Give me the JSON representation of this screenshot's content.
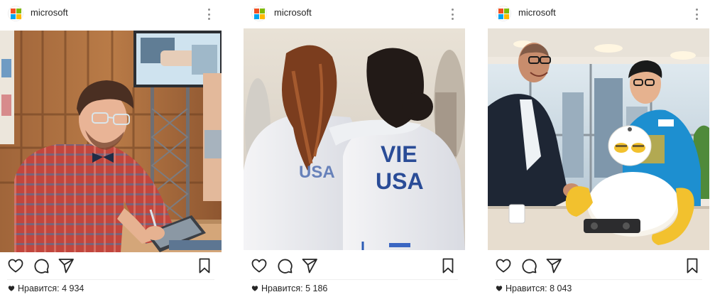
{
  "brand": {
    "logo_colors": [
      "#f25022",
      "#7fba00",
      "#00a4ef",
      "#ffb900"
    ]
  },
  "icons": {
    "like": "heart-outline-icon",
    "comment": "comment-bubble-icon",
    "share": "paper-plane-icon",
    "save": "bookmark-icon",
    "more": "three-dots-vertical-icon",
    "likes_marker": "heart-filled-icon"
  },
  "posts": [
    {
      "username": "microsoft",
      "photo": "man with glasses and red shirt drawing on a tablet with stylus",
      "likes_label": "Нравится: 4 934"
    },
    {
      "username": "microsoft",
      "photo": "two fencers from behind with arms around each other, jackets reading USA and VIE USA",
      "jacket_text_left": "USA",
      "jacket_text_right_top": "VIE",
      "jacket_text_right_bottom": "USA",
      "likes_label": "Нравится: 5 186"
    },
    {
      "username": "microsoft",
      "photo": "man in suit and boy in blue shirt looking at a white and yellow robot on a table",
      "likes_label": "Нравится: 8 043"
    }
  ]
}
